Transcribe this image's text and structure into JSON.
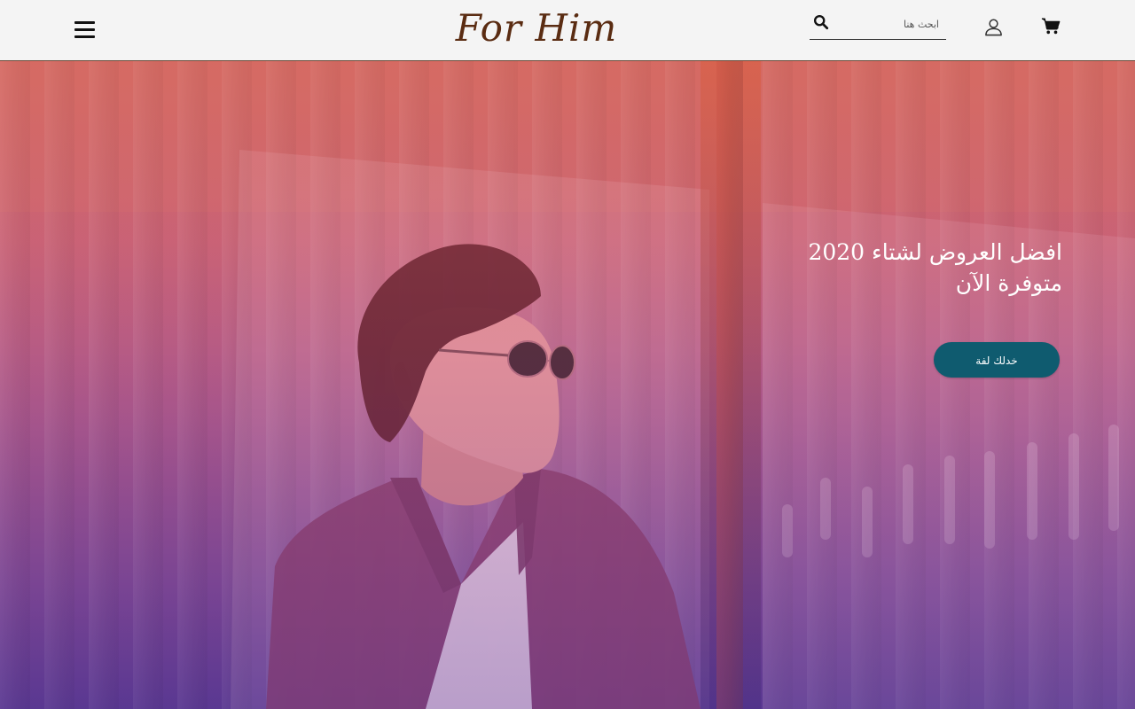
{
  "header": {
    "logo": "For Him",
    "search": {
      "placeholder": "ابحث هنا",
      "value": ""
    },
    "icons": [
      "menu-icon",
      "search-icon",
      "user-icon",
      "cart-icon"
    ]
  },
  "hero": {
    "headline_line1": "افضل العروض لشتاء 2020",
    "headline_line2": "متوفرة الآن",
    "cta_label": "خدلك لفة"
  },
  "colors": {
    "topbar_bg": "#f4f4f4",
    "logo": "#5a2c12",
    "cta_bg": "#0f5b6f",
    "hero_top": "#cf6a66",
    "hero_bottom": "#57388f"
  }
}
